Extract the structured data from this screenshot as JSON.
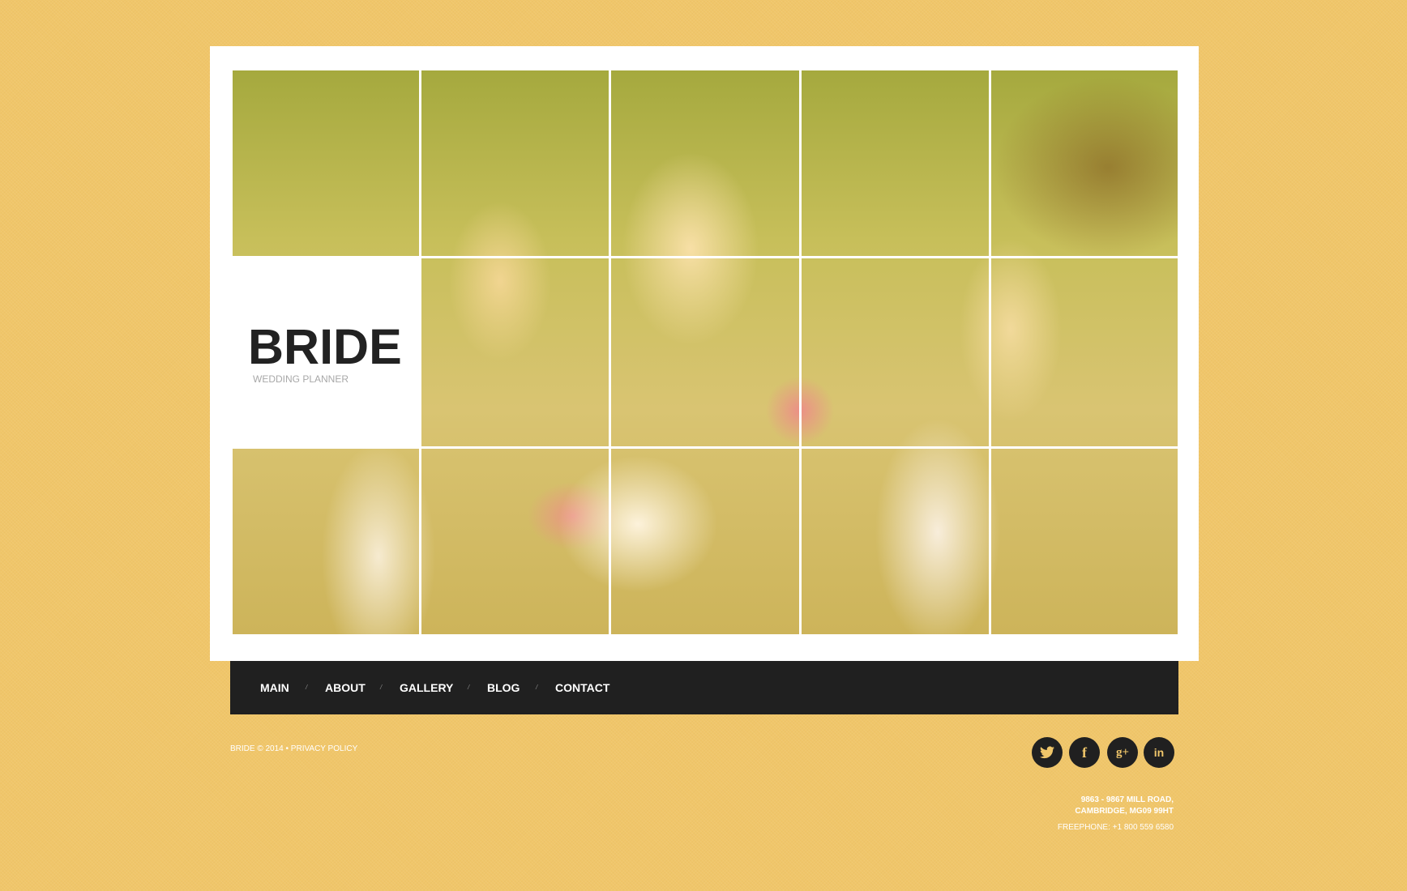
{
  "brand": {
    "title": "BRIDE",
    "subtitle": "WEDDING PLANNER"
  },
  "hero": {
    "image_description": "bride with two flower girls holding pink and white bouquets, split into 5x3 grid tiles",
    "tile_columns": 5,
    "tile_rows": 3
  },
  "nav": {
    "items": [
      {
        "label": "MAIN"
      },
      {
        "label": "ABOUT"
      },
      {
        "label": "GALLERY"
      },
      {
        "label": "BLOG"
      },
      {
        "label": "CONTACT"
      }
    ],
    "separator": "/"
  },
  "footer": {
    "copyright": "BRIDE © 2014 •",
    "privacy_label": "PRIVACY POLICY",
    "social": [
      {
        "name": "twitter",
        "glyph": "t"
      },
      {
        "name": "facebook",
        "glyph": "f"
      },
      {
        "name": "google-plus",
        "glyph": "g+"
      },
      {
        "name": "linkedin",
        "glyph": "in"
      }
    ],
    "address_line1": "9863 - 9867 MILL ROAD,",
    "address_line2": "CAMBRIDGE, MG09 99HT",
    "phone": "FREEPHONE:  +1 800 559 6580"
  },
  "colors": {
    "background": "#f0c66a",
    "nav_bg": "#202020",
    "logo_text": "#222222",
    "subtitle_text": "#a8a8a8",
    "icon_glyph": "#f0c66a"
  }
}
